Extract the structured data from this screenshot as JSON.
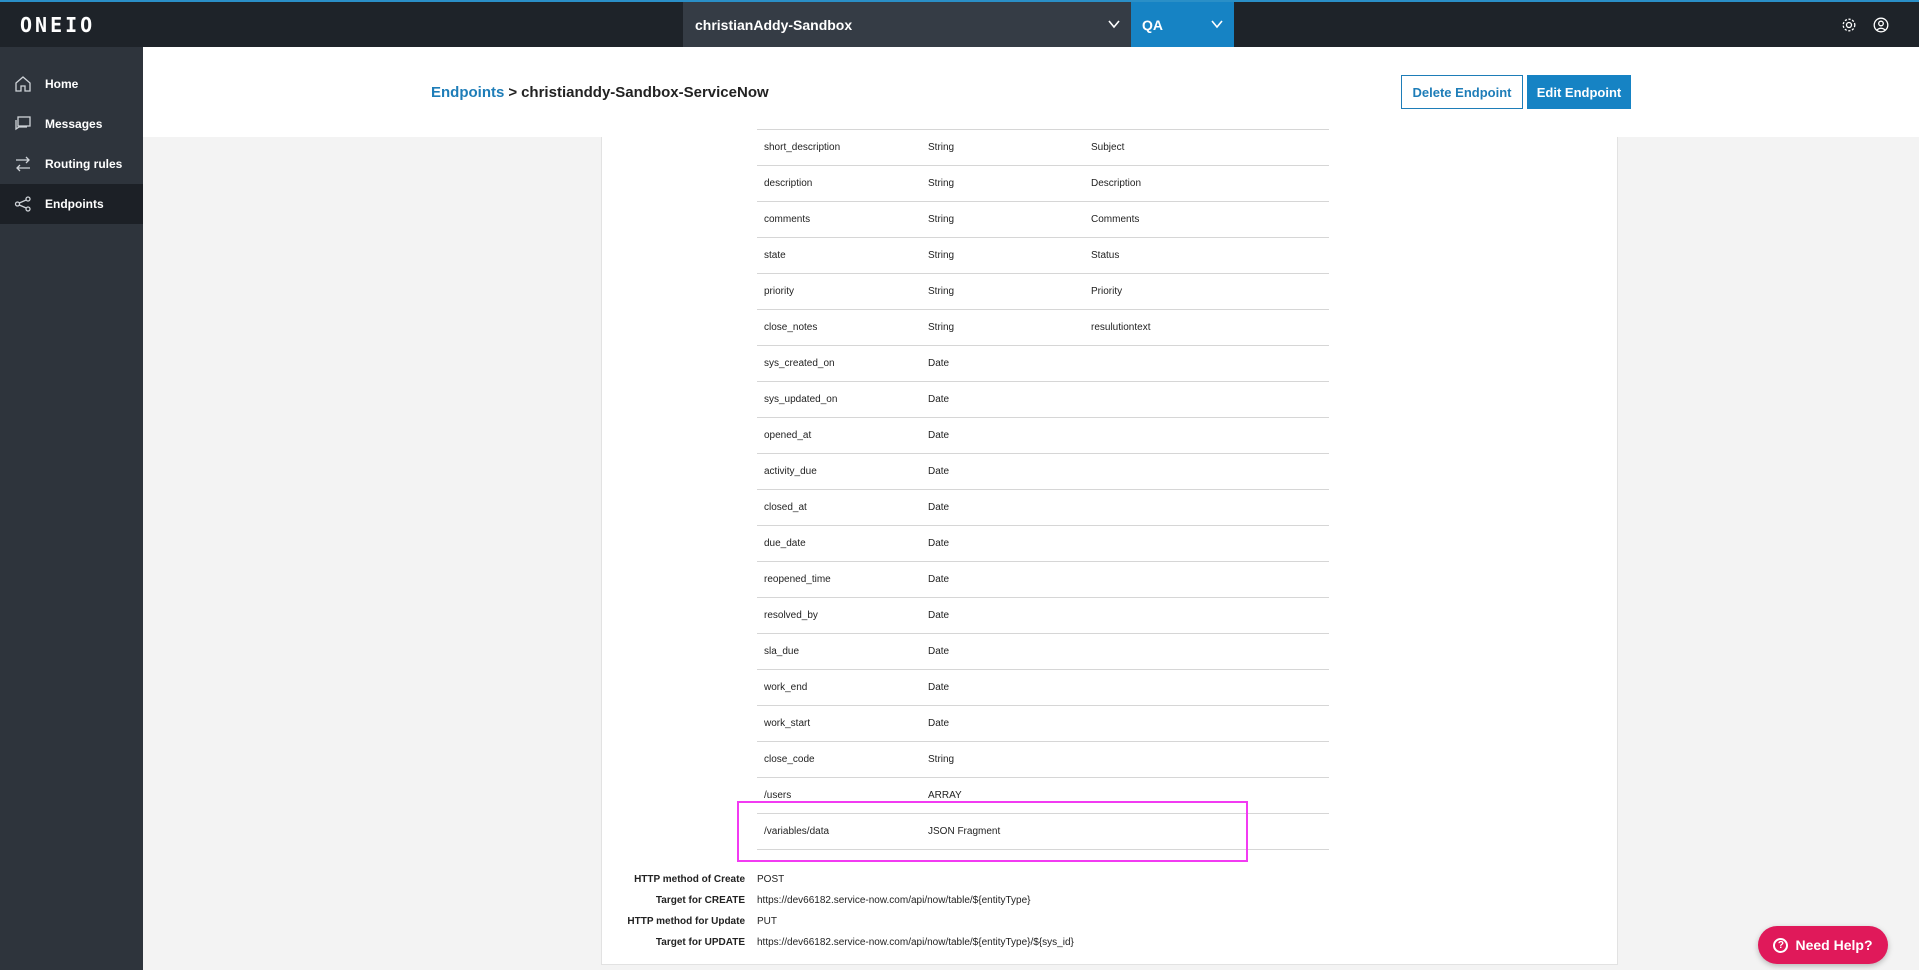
{
  "topbar": {
    "logo_text": "ONEIO",
    "environment": "christianAddy-Sandbox",
    "stage": "QA",
    "icons": [
      "gear-icon",
      "user-icon"
    ]
  },
  "sidebar": {
    "items": [
      {
        "label": "Home",
        "icon": "home-icon"
      },
      {
        "label": "Messages",
        "icon": "messages-icon"
      },
      {
        "label": "Routing rules",
        "icon": "routing-icon"
      },
      {
        "label": "Endpoints",
        "icon": "endpoints-icon",
        "active": true
      }
    ]
  },
  "header": {
    "breadcrumb_link": "Endpoints",
    "breadcrumb_sep": ">",
    "breadcrumb_current": "christianddy-Sandbox-ServiceNow",
    "delete_label": "Delete Endpoint",
    "edit_label": "Edit Endpoint"
  },
  "fields": [
    {
      "name": "short_description",
      "type": "String",
      "mapped": "Subject"
    },
    {
      "name": "description",
      "type": "String",
      "mapped": "Description"
    },
    {
      "name": "comments",
      "type": "String",
      "mapped": "Comments"
    },
    {
      "name": "state",
      "type": "String",
      "mapped": "Status"
    },
    {
      "name": "priority",
      "type": "String",
      "mapped": "Priority"
    },
    {
      "name": "close_notes",
      "type": "String",
      "mapped": "resulutiontext"
    },
    {
      "name": "sys_created_on",
      "type": "Date",
      "mapped": ""
    },
    {
      "name": "sys_updated_on",
      "type": "Date",
      "mapped": ""
    },
    {
      "name": "opened_at",
      "type": "Date",
      "mapped": ""
    },
    {
      "name": "activity_due",
      "type": "Date",
      "mapped": ""
    },
    {
      "name": "closed_at",
      "type": "Date",
      "mapped": ""
    },
    {
      "name": "due_date",
      "type": "Date",
      "mapped": ""
    },
    {
      "name": "reopened_time",
      "type": "Date",
      "mapped": ""
    },
    {
      "name": "resolved_by",
      "type": "Date",
      "mapped": ""
    },
    {
      "name": "sla_due",
      "type": "Date",
      "mapped": ""
    },
    {
      "name": "work_end",
      "type": "Date",
      "mapped": ""
    },
    {
      "name": "work_start",
      "type": "Date",
      "mapped": ""
    },
    {
      "name": "close_code",
      "type": "String",
      "mapped": ""
    },
    {
      "name": "/users",
      "type": "ARRAY",
      "mapped": ""
    },
    {
      "name": "/variables/data",
      "type": "JSON Fragment",
      "mapped": ""
    }
  ],
  "meta": [
    {
      "label": "HTTP method of Create",
      "value": "POST"
    },
    {
      "label": "Target for CREATE",
      "value": "https://dev66182.service-now.com/api/now/table/${entityType}"
    },
    {
      "label": "HTTP method for Update",
      "value": "PUT"
    },
    {
      "label": "Target for UPDATE",
      "value": "https://dev66182.service-now.com/api/now/table/${entityType}/${sys_id}"
    }
  ],
  "help": {
    "label": "Need Help?"
  },
  "colors": {
    "accent": "#1683c4",
    "highlight": "#f23bf2",
    "help": "#e0195a"
  }
}
